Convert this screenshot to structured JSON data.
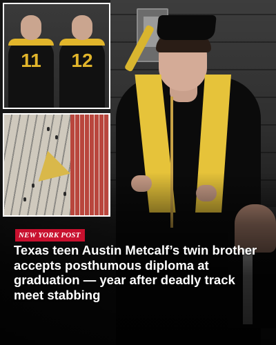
{
  "publisher": {
    "name": "NEW YORK POST",
    "brand_color": "#c8102e"
  },
  "headline": "Texas teen Austin Metcalf’s twin brother accepts posthumous diploma at graduation — year after deadly track meet stabbing",
  "inset_top": {
    "jersey_left": "11",
    "jersey_right": "12",
    "team_color": "#e1b52b"
  },
  "colors": {
    "stole": "#e6c33a",
    "gown": "#0b0b0b"
  }
}
